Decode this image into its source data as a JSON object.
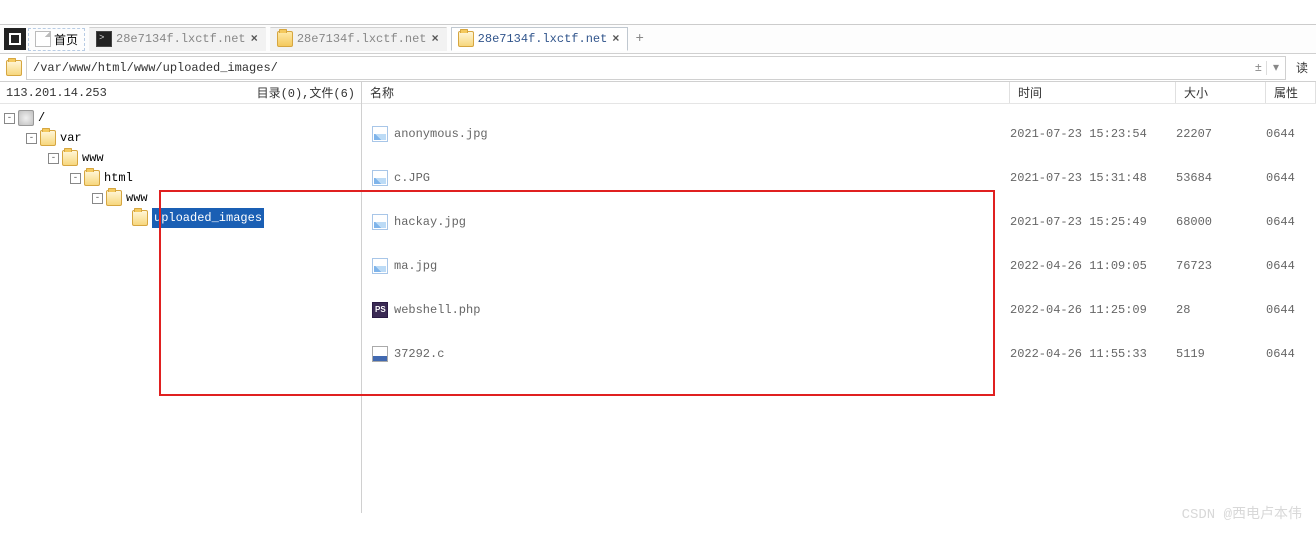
{
  "toolbar": {
    "home_label": "首页",
    "tabs": [
      {
        "label": "28e7134f.lxctf.net",
        "type": "term",
        "active": false
      },
      {
        "label": "28e7134f.lxctf.net",
        "type": "folder",
        "active": false
      },
      {
        "label": "28e7134f.lxctf.net",
        "type": "folder",
        "active": true
      }
    ]
  },
  "address": {
    "path": "/var/www/html/www/uploaded_images/",
    "read_label": "读"
  },
  "left": {
    "host": "113.201.14.253",
    "dir_label": "目录(0),文件(6)"
  },
  "tree": {
    "root": "/",
    "nodes": [
      "var",
      "www",
      "html",
      "www",
      "uploaded_images"
    ]
  },
  "columns": {
    "name": "名称",
    "time": "时间",
    "size": "大小",
    "attr": "属性"
  },
  "files": [
    {
      "name": "anonymous.jpg",
      "time": "2021-07-23 15:23:54",
      "size": "22207",
      "attr": "0644",
      "icon": "img"
    },
    {
      "name": "c.JPG",
      "time": "2021-07-23 15:31:48",
      "size": "53684",
      "attr": "0644",
      "icon": "img"
    },
    {
      "name": "hackay.jpg",
      "time": "2021-07-23 15:25:49",
      "size": "68000",
      "attr": "0644",
      "icon": "img"
    },
    {
      "name": "ma.jpg",
      "time": "2022-04-26 11:09:05",
      "size": "76723",
      "attr": "0644",
      "icon": "img"
    },
    {
      "name": "webshell.php",
      "time": "2022-04-26 11:25:09",
      "size": "28",
      "attr": "0644",
      "icon": "php"
    },
    {
      "name": "37292.c",
      "time": "2022-04-26 11:55:33",
      "size": "5119",
      "attr": "0644",
      "icon": "file"
    }
  ],
  "watermark": "CSDN @西电卢本伟"
}
